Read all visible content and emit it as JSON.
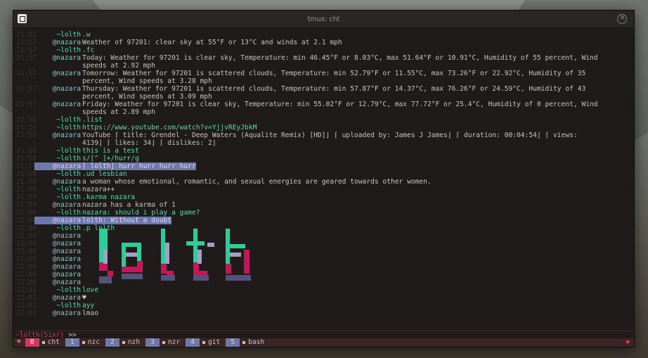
{
  "window": {
    "title": "tmux: cht"
  },
  "lines": [
    {
      "ts": "21:57",
      "nick": "~lolth",
      "nk": "lolth",
      "msg": ".w",
      "cmd": true
    },
    {
      "ts": "21:57",
      "nick": "@nazara",
      "nk": "nazara",
      "msg": "Weather of 97201: clear sky at 55°F or 13°C and winds at 2.1 mph"
    },
    {
      "ts": "21:57",
      "nick": "~lolth",
      "nk": "lolth",
      "msg": ".fc",
      "cmd": true
    },
    {
      "ts": "21:57",
      "nick": "@nazara",
      "nk": "nazara",
      "msg": "Today: Weather for 97201 is clear sky, Temperature: min 46.45°F or 8.03°C, max 51.64°F or 10.91°C, Humidity of 55 percent, Wind"
    },
    {
      "ts": "",
      "nick": "",
      "nk": "",
      "msg": "speeds at 2.92 mph"
    },
    {
      "ts": "21:57",
      "nick": "@nazara",
      "nk": "nazara",
      "msg": "Tomorrow: Weather for 97201 is scattered clouds, Temperature: min 52.79°F or 11.55°C, max 73.26°F or 22.92°C, Humidity of 35"
    },
    {
      "ts": "",
      "nick": "",
      "nk": "",
      "msg": "percent, Wind speeds at 3.28 mph"
    },
    {
      "ts": "21:57",
      "nick": "@nazara",
      "nk": "nazara",
      "msg": "Thursday: Weather for 97201 is scattered clouds, Temperature: min 57.87°F or 14.37°C, max 76.26°F or 24.59°C, Humidity of 43"
    },
    {
      "ts": "",
      "nick": "",
      "nk": "",
      "msg": "percent, Wind speeds at 3.09 mph"
    },
    {
      "ts": "21:57",
      "nick": "@nazara",
      "nk": "nazara",
      "msg": "Friday: Weather for 97201 is clear sky, Temperature: min 55.02°F or 12.79°C, max 77.72°F or 25.4°C, Humidity of 0 percent, Wind"
    },
    {
      "ts": "",
      "nick": "",
      "nk": "",
      "msg": "speeds at 2.89 mph"
    },
    {
      "ts": "21:58",
      "nick": "~lolth",
      "nk": "lolth",
      "msg": ".list",
      "cmd": true
    },
    {
      "ts": "21:59",
      "nick": "~lolth",
      "nk": "lolth",
      "msg": "https://www.youtube.com/watch?v=YjjvREyJbkM",
      "cmd": true
    },
    {
      "ts": "21:59",
      "nick": "@nazara",
      "nk": "nazara",
      "msg": "YouTube ⌈ title: Grendel - Deep Waters (Aqualite Remix) [HD]⌋ ⌈ uploaded by: James J James⌋ ⌈ duration: 00:04:54⌋ ⌈ views:"
    },
    {
      "ts": "",
      "nick": "",
      "nk": "",
      "msg": "4139⌋ ⌈ likes: 34⌋ ⌈ dislikes: 2⌋"
    },
    {
      "ts": "21:59",
      "nick": "~lolth",
      "nk": "lolth",
      "msg": "this is a test",
      "cmd": true
    },
    {
      "ts": "21:59",
      "nick": "~lolth",
      "nk": "lolth",
      "msg": "s/[^ ]+/hurr/g",
      "cmd": true
    },
    {
      "ts": "21:59",
      "nick": "@nazara",
      "nk": "hl",
      "msg": "⌈ lolth⌋ hurr hurr hurr hurr",
      "hl": true
    },
    {
      "ts": "21:59",
      "nick": "~lolth",
      "nk": "lolth",
      "msg": ".ud lesbian",
      "cmd": true
    },
    {
      "ts": "21:59",
      "nick": "@nazara",
      "nk": "nazara",
      "msg": "a woman whose emotional, romantic, and sexual energies are geared towards other women."
    },
    {
      "ts": "21:59",
      "nick": "~lolth",
      "nk": "lolth",
      "msg": "nazara++"
    },
    {
      "ts": "21:59",
      "nick": "~lolth",
      "nk": "lolth",
      "msg": ".karma nazara",
      "cmd": true
    },
    {
      "ts": "21:59",
      "nick": "@nazara",
      "nk": "nazara",
      "msg": "nazara has a karma of 1"
    },
    {
      "ts": "22:00",
      "nick": "~lolth",
      "nk": "lolth",
      "msg": "nazara: should i play a game?",
      "cmd": true
    },
    {
      "ts": "22:00",
      "nick": "@nazara",
      "nk": "hl",
      "msg": "lolth: Without a doubt",
      "hl": true
    },
    {
      "ts": "22:00",
      "nick": "~lolth",
      "nk": "lolth",
      "msg": ".p lolth",
      "cmd": true
    },
    {
      "ts": "22:00",
      "nick": "@nazara",
      "nk": "nazara",
      "msg": ""
    },
    {
      "ts": "22:00",
      "nick": "@nazara",
      "nk": "nazara",
      "msg": ""
    },
    {
      "ts": "22:00",
      "nick": "@nazara",
      "nk": "nazara",
      "msg": ""
    },
    {
      "ts": "22:00",
      "nick": "@nazara",
      "nk": "nazara",
      "msg": ""
    },
    {
      "ts": "22:00",
      "nick": "@nazara",
      "nk": "nazara",
      "msg": ""
    },
    {
      "ts": "22:00",
      "nick": "@nazara",
      "nk": "nazara",
      "msg": ""
    },
    {
      "ts": "22:00",
      "nick": "@nazara",
      "nk": "nazara",
      "msg": ""
    },
    {
      "ts": "22:01",
      "nick": "~lolth",
      "nk": "lolth",
      "msg": "love",
      "cmd": true
    },
    {
      "ts": "22:01",
      "nick": "@nazara",
      "nk": "nazara",
      "msg": "♥"
    },
    {
      "ts": "22:01",
      "nick": "~lolth",
      "nk": "lolth",
      "msg": "ayy",
      "cmd": true
    },
    {
      "ts": "22:01",
      "nick": "@nazara",
      "nk": "nazara",
      "msg": "lmao"
    }
  ],
  "input": {
    "prompt": "~lolth(Sixr)",
    "caret": ">>"
  },
  "windows": [
    {
      "num": "0",
      "name": "cht",
      "active": true
    },
    {
      "num": "1",
      "name": "nzc"
    },
    {
      "num": "2",
      "name": "nzh"
    },
    {
      "num": "3",
      "name": "nzr"
    },
    {
      "num": "4",
      "name": "git"
    },
    {
      "num": "5",
      "name": "bash"
    }
  ],
  "colors": {
    "accent": "#d7375f",
    "teal": "#5fd7af",
    "highlight": "#6f78a8",
    "background": "#1f1b1b"
  }
}
